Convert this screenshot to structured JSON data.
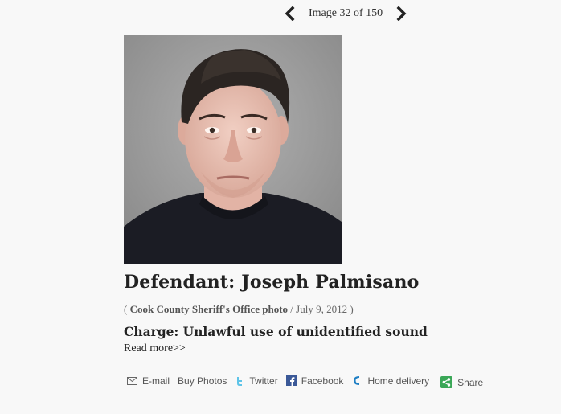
{
  "pager": {
    "prev_icon": "chevron-left-icon",
    "label": "Image 32 of 150",
    "next_icon": "chevron-right-icon"
  },
  "photo": {
    "alt": "Mugshot of Joseph Palmisano"
  },
  "headline": "Defendant: Joseph Palmisano",
  "credit": {
    "open": "( ",
    "source": "Cook County Sheriff's Office photo",
    "sep": " / July 9, 2012 )"
  },
  "charge": "Charge: Unlawful use of unidentified sound",
  "read_more": "Read more>>",
  "share_bar": {
    "email": "E-mail",
    "buy_photos": "Buy Photos",
    "twitter": "Twitter",
    "facebook": "Facebook",
    "home_delivery": "Home delivery",
    "share": "Share"
  },
  "colors": {
    "background": "#f8f8f8",
    "twitter": "#5ec4e8",
    "facebook": "#3b5998",
    "home_delivery": "#1f7fc4",
    "share": "#3aa757"
  }
}
